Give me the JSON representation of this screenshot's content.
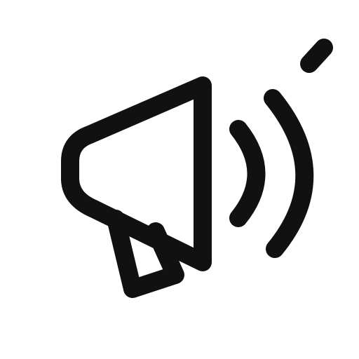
{
  "icon": {
    "name": "megaphone-icon",
    "stroke_color": "#111111",
    "background_color": "#ffffff"
  }
}
